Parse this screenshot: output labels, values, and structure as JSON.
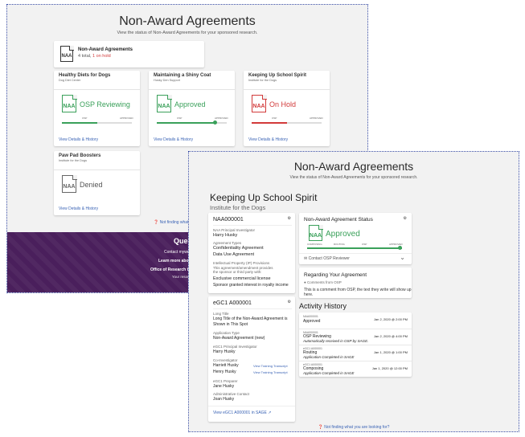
{
  "back": {
    "title": "Non-Award Agreements",
    "subtitle": "View the status of Non-Award Agreements for your sponsored research.",
    "summary": {
      "icon_text": "NAA",
      "title": "Non-Award Agreements",
      "total": "4 total, ",
      "on_hold": "1 on hold"
    },
    "cards": [
      {
        "name": "Healthy Diets for Dogs",
        "sponsor": "Dog Diet Center",
        "icon_text": "NAA",
        "status": "OSP Reviewing",
        "step1": "OSP",
        "step2": "APPROVED",
        "progress": 0.5,
        "link": "View Details & History",
        "color": "#3aa05a"
      },
      {
        "name": "Maintaining a Shiny Coat",
        "sponsor": "Husky Den Support",
        "icon_text": "NAA",
        "status": "Approved",
        "step1": "OSP",
        "step2": "APPROVED",
        "progress": 1.0,
        "link": "View Details & History",
        "color": "#3aa05a"
      },
      {
        "name": "Keeping Up School Spirit",
        "sponsor": "Institute for the Dogs",
        "icon_text": "NAA",
        "status": "On Hold",
        "step1": "OSP",
        "step2": "APPROVED",
        "progress": 0.5,
        "link": "View Details & History",
        "color": "#d23a3a"
      },
      {
        "name": "Paw Pad Boosters",
        "sponsor": "Institute for the Dogs",
        "icon_text": "NAA",
        "status": "Denied",
        "link": "View Details & History",
        "color": "#666666"
      }
    ],
    "not_finding": "Not finding what",
    "footer": {
      "heading": "Quest",
      "line1": "Contact mywe",
      "line2": "Learn more abou",
      "line3": "Office of Research tr",
      "line4": "Your resou"
    }
  },
  "front": {
    "title": "Non-Award Agreements",
    "subtitle": "View the status of Non-Award Agreements for your sponsored research.",
    "project_title": "Keeping Up School Spirit",
    "project_sponsor": "Institute for the Dogs",
    "naa": {
      "id": "NAA000001",
      "pi_label": "NAA Principal Investigator",
      "pi": "Harry Husky",
      "types_label": "Agreement Types",
      "type1": "Confidentiality Agreement",
      "type2": "Data Use Agreement",
      "ip_label": "Intellectual Property (IP) Provisions",
      "ip_note1": "This agreement/amendment provides",
      "ip_note2": "the sponsor or third party with:",
      "ip1": "Exclusive commercial license",
      "ip2": "Sponsor granted interest in royalty income"
    },
    "status_card": {
      "title": "Non-Award Agreement Status",
      "icon_text": "NAA",
      "status": "Approved",
      "steps": [
        "COMPOSING",
        "ROUTING",
        "OSP",
        "APPROVED"
      ],
      "progress": 1.0,
      "contact": "Contact OSP Reviewer"
    },
    "comment_card": {
      "title": "Regarding Your Agreement",
      "from": "Comments from OSP",
      "text": "This is a comment from OSP, the text they write will show up here."
    },
    "egc1": {
      "id": "eGC1 A000001",
      "long_title_label": "Long Title",
      "long_title1": "Long Title of the Non-Award Agreement is",
      "long_title2": "Shown in This Spot",
      "app_type_label": "Application Type",
      "app_type": "Non-Award Agreement (new)",
      "pi_label": "eGC1 Principal Investigator",
      "pi": "Harry Husky",
      "coi_label": "Co-Investigator",
      "coi1": "Harriett Husky",
      "coi2": "Henry Husky",
      "transcript": "View Training Transcript",
      "preparer_label": "eGC1 Preparer",
      "preparer": "Jane Husky",
      "admin_label": "Administrative Contact",
      "admin": "Joan Husky",
      "link": "View eGC1 A000001 in SAGE"
    },
    "activity": {
      "title": "Activity History",
      "rows": [
        {
          "id": "NAA000001",
          "event": "Approved",
          "detail": "",
          "date": "Jan 2, 2020 @ 2:00 PM"
        },
        {
          "id": "NAA000001",
          "event": "OSP Reviewing",
          "detail": "Automatically received in OSP by SAGE.",
          "date": "Jan 2, 2020 @ 4:00 PM"
        },
        {
          "id": "eGC1 A000001",
          "event": "Routing",
          "detail": "Application Completed in SAGE",
          "date": "Jan 1, 2020 @ 1:00 PM"
        },
        {
          "id": "eGC1 A000001",
          "event": "Composing",
          "detail": "Application Completed in SAGE",
          "date": "Jan 1, 2020 @ 12:00 PM"
        }
      ]
    },
    "not_finding": "Not finding what you are looking for?"
  }
}
